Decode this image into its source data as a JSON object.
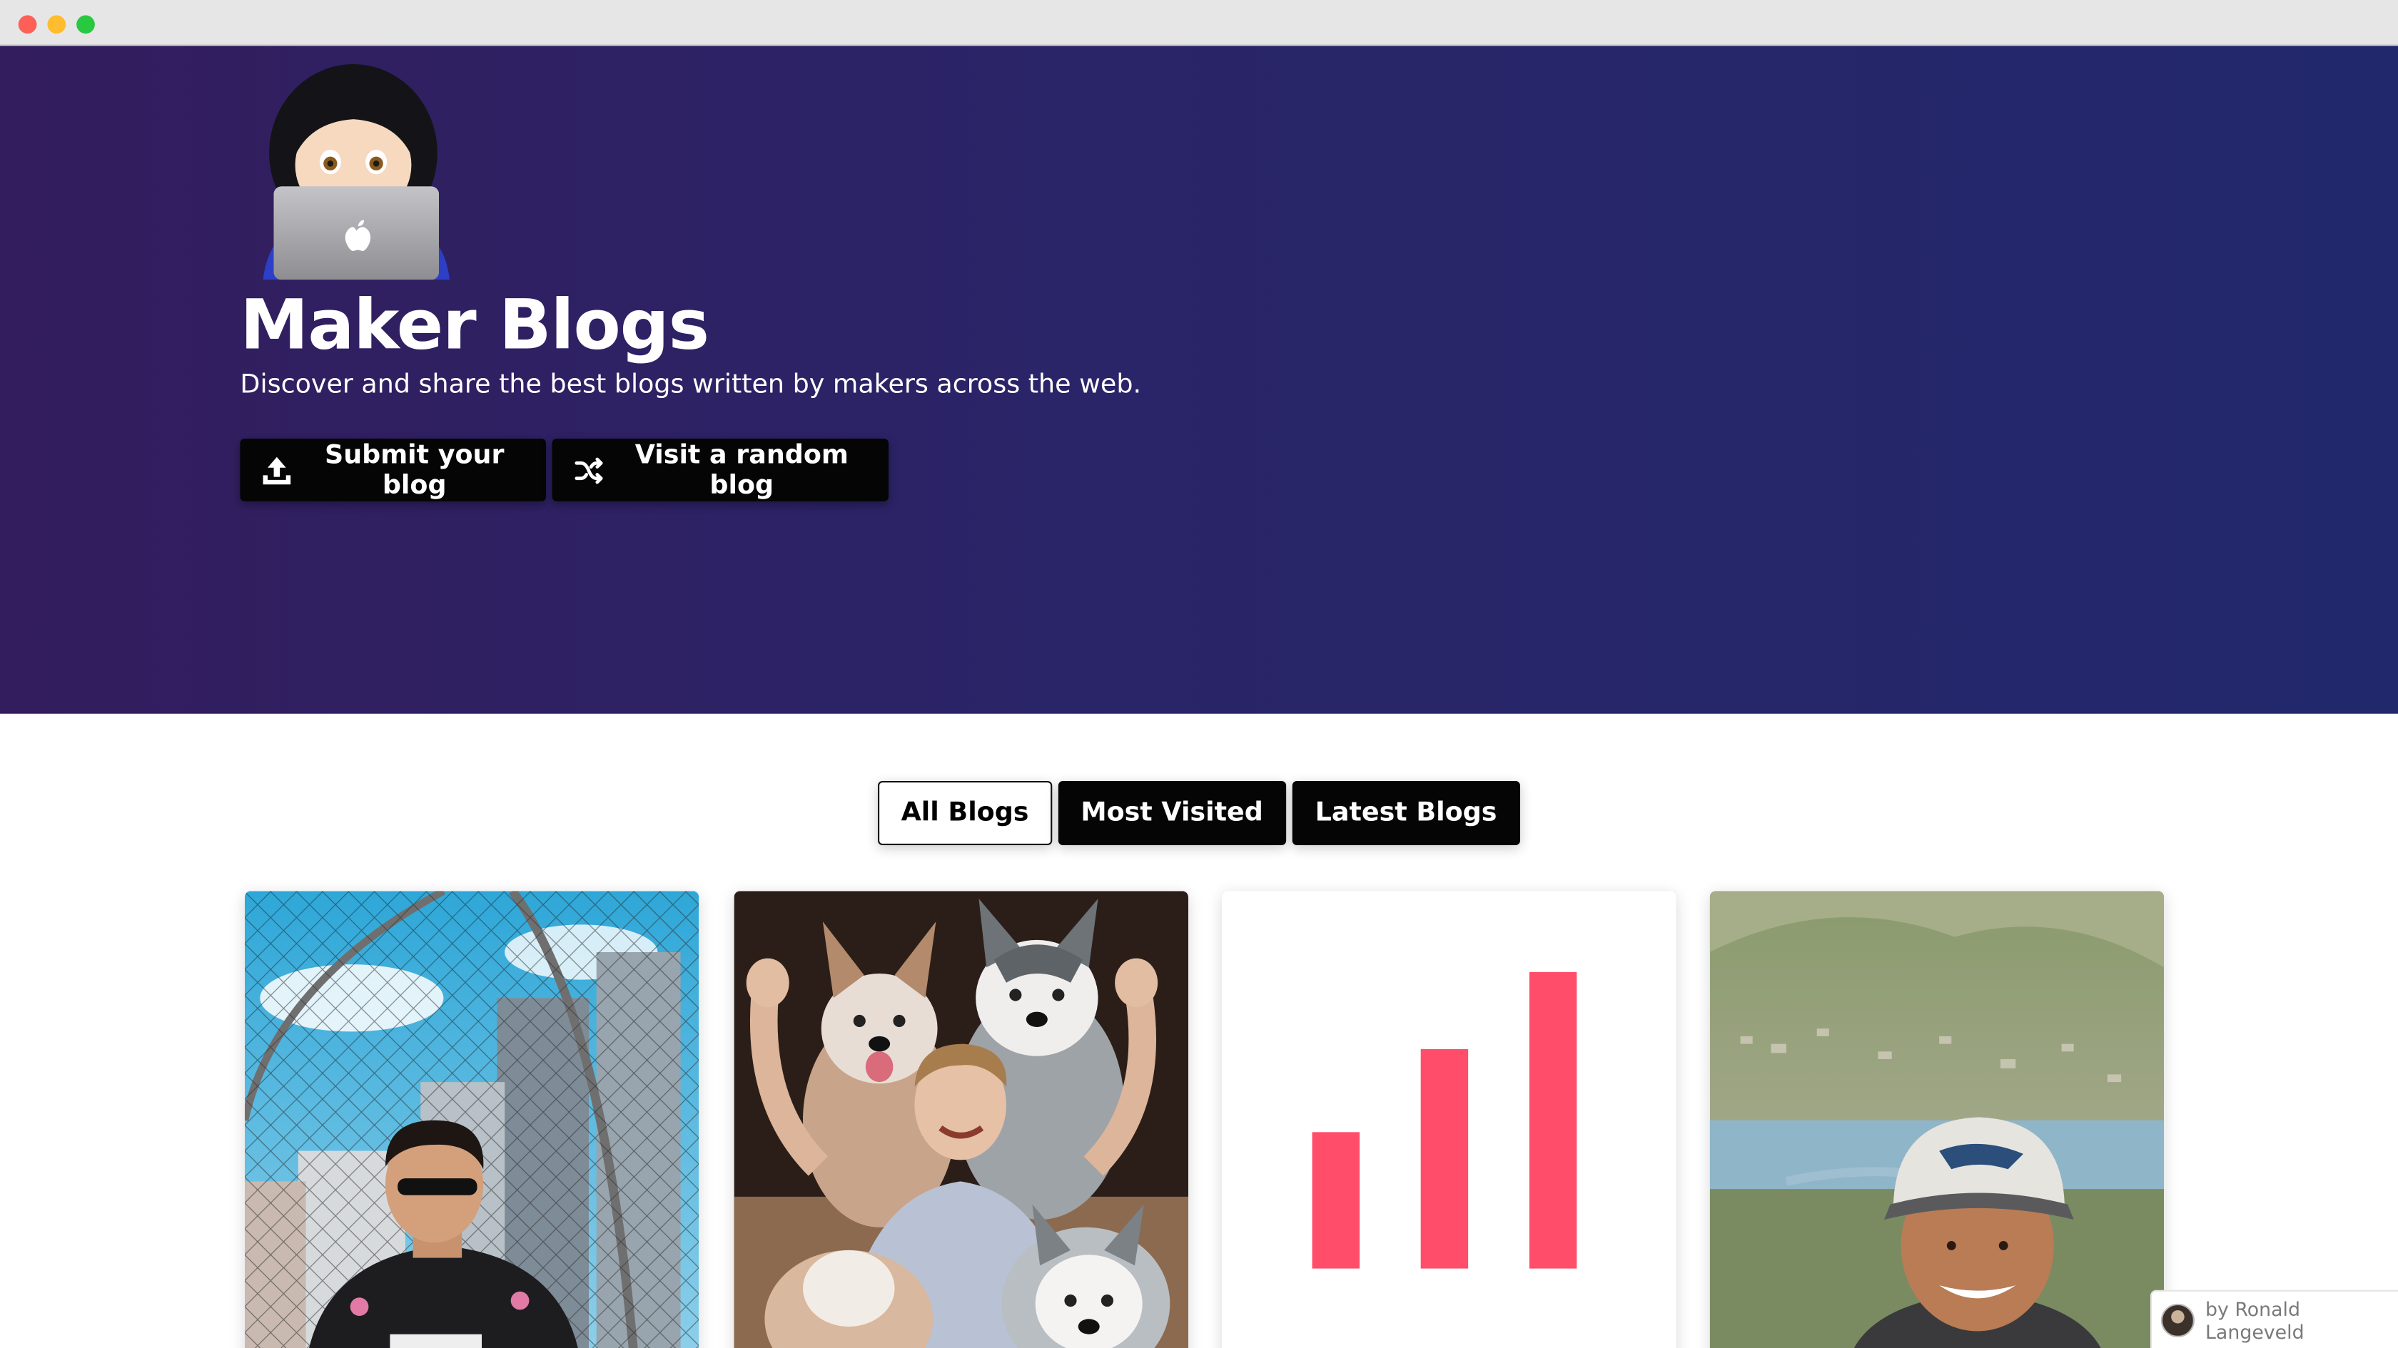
{
  "hero": {
    "emoji": "woman-technologist-emoji",
    "title": "Maker Blogs",
    "subtitle": "Discover and share the best blogs written by makers across the web.",
    "buttons": [
      {
        "label": "Submit your blog",
        "icon": "upload-icon"
      },
      {
        "label": "Visit a random blog",
        "icon": "shuffle-icon"
      }
    ]
  },
  "tabs": [
    {
      "label": "All Blogs",
      "active": true
    },
    {
      "label": "Most Visited",
      "active": false
    },
    {
      "label": "Latest Blogs",
      "active": false
    }
  ],
  "cards": [
    {
      "image": "man-with-sunglasses-city-fence-photo"
    },
    {
      "image": "man-with-husky-dogs-photo"
    },
    {
      "image": "bar-chart-logo",
      "bar_color": "#ff4d6a",
      "bar_levels": [
        0.46,
        0.74,
        1.0
      ]
    },
    {
      "image": "man-with-cap-landscape-photo"
    }
  ],
  "credit": {
    "text": "by Ronald Langeveld",
    "icon": "avatar"
  },
  "colors": {
    "hero_gradient_start": "#331d5e",
    "hero_gradient_end": "#22286c",
    "button_bg": "#050505",
    "accent_bar": "#ff4d6a"
  }
}
